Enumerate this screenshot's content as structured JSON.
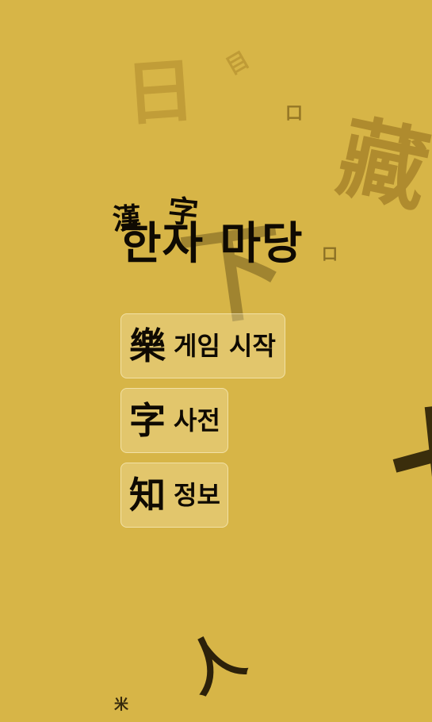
{
  "theme": {
    "background": "#d7b547",
    "text": "#0f0a02",
    "faint_char": "#b08a2c",
    "dark_char": "#3d2c08"
  },
  "title": {
    "text": "한자 마당",
    "hanja_1": "漢",
    "hanja_2": "字"
  },
  "menu": {
    "start": {
      "hanja": "樂",
      "label": "게임 시작"
    },
    "dictionary": {
      "hanja": "字",
      "label": "사전"
    },
    "info": {
      "hanja": "知",
      "label": "정보"
    }
  },
  "background_chars": {
    "c1": "日",
    "c2": "目",
    "c3": "口",
    "c4": "藏",
    "c5": "口",
    "c6": "下",
    "c7": "七",
    "c8": "人",
    "c9": "米"
  }
}
